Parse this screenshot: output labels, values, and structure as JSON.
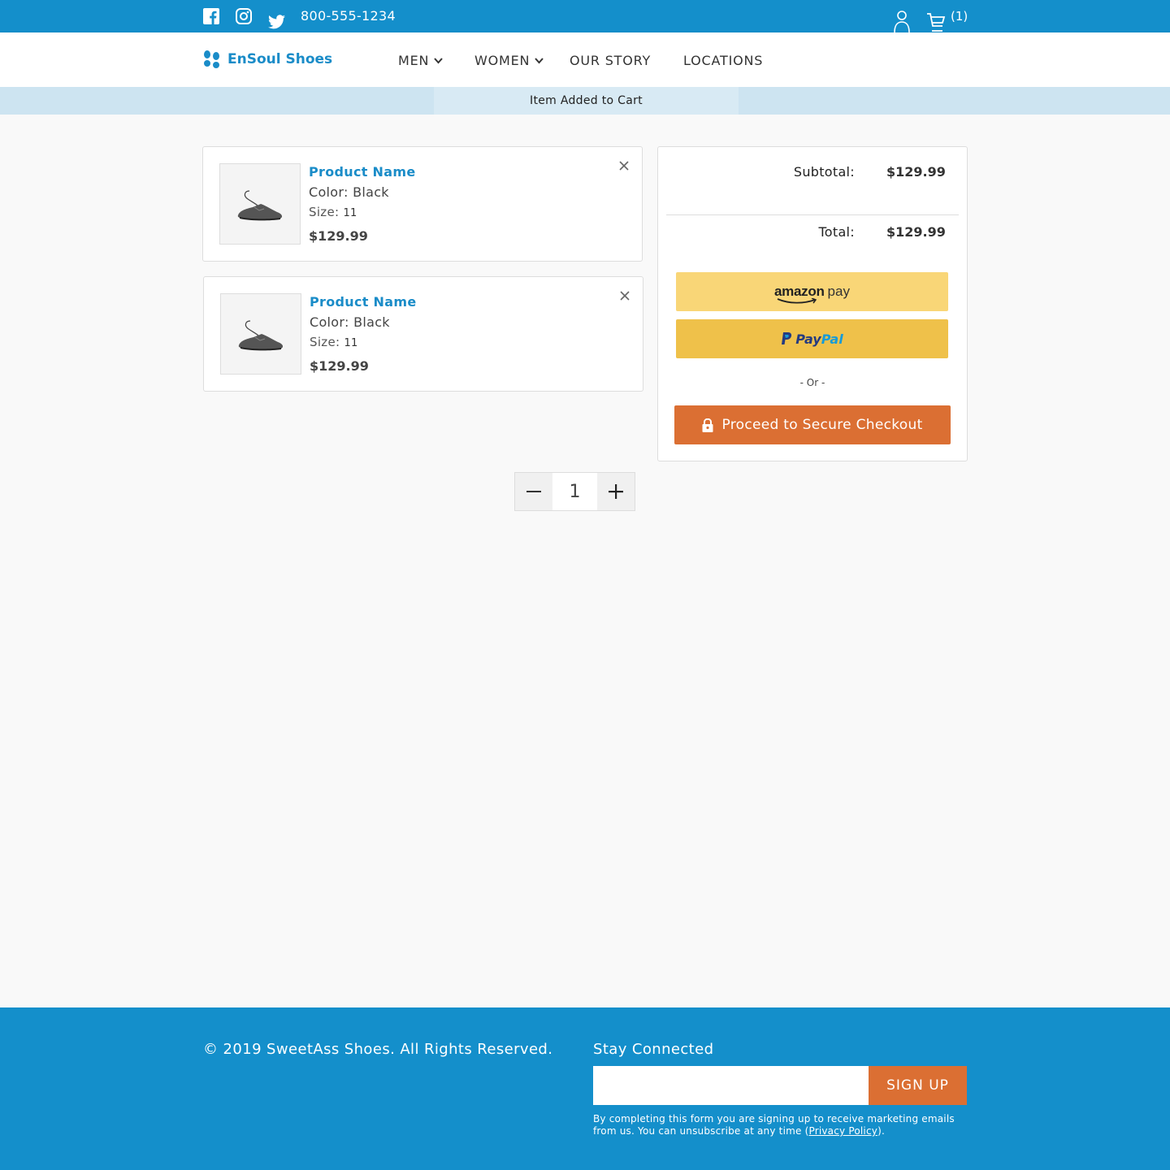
{
  "topbar": {
    "phone": "800-555-1234",
    "cart_count": "(1)",
    "icons": [
      "facebook-icon",
      "instagram-icon",
      "twitter-icon",
      "account-icon",
      "cart-icon"
    ]
  },
  "brand": {
    "name": "EnSoul Shoes"
  },
  "nav": {
    "items": [
      {
        "label": "MEN",
        "has_dropdown": true
      },
      {
        "label": "WOMEN",
        "has_dropdown": true
      },
      {
        "label": "OUR STORY",
        "has_dropdown": false
      },
      {
        "label": "LOCATIONS",
        "has_dropdown": false
      }
    ]
  },
  "notice": "Item Added to Cart",
  "cart": {
    "items": [
      {
        "name": "Product Name",
        "color_label": "Color: Black",
        "size_label": "Size:",
        "size": "11",
        "price": "$129.99"
      },
      {
        "name": "Product Name",
        "color_label": "Color: Black",
        "size_label": "Size:",
        "size": "11",
        "price": "$129.99"
      }
    ]
  },
  "summary": {
    "subtotal_label": "Subtotal:",
    "subtotal": "$129.99",
    "total_label": "Total:",
    "total": "$129.99",
    "amazon_pay": {
      "word": "amazon",
      "suffix": "pay"
    },
    "paypal": {
      "pay": "Pay",
      "pal": "Pal"
    },
    "or": "- Or -",
    "checkout": "Proceed to Secure Checkout"
  },
  "quantity": {
    "value": "1",
    "minus": "−",
    "plus": "+"
  },
  "footer": {
    "copyright": "© 2019 SweetAss Shoes. All Rights Reserved.",
    "stay_connected": "Stay Connected",
    "email_placeholder": "",
    "signup": "SIGN UP",
    "disclaimer_prefix": "By completing this form you are signing up to receive marketing emails from us. You can unsubscribe at any time (",
    "privacy_link": "Privacy Policy",
    "disclaimer_suffix": ")."
  },
  "colors": {
    "brand_blue": "#148fcb",
    "accent_orange": "#db6f33",
    "amazon_yellow": "#f9d677",
    "paypal_yellow": "#efc14a"
  }
}
